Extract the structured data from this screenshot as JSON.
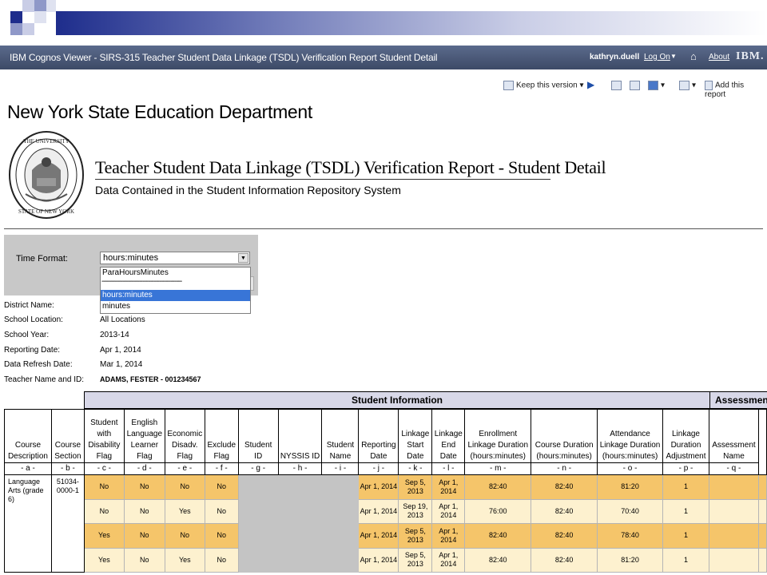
{
  "window": {
    "title": "IBM Cognos Viewer - SIRS-315 Teacher Student Data Linkage (TSDL) Verification Report Student Detail",
    "user": "kathryn.duell",
    "log_on": "Log On",
    "about": "About",
    "brand": "IBM."
  },
  "toolbar": {
    "keep_version": "Keep this version",
    "add_report": "Add this report"
  },
  "report": {
    "org": "New York State Education Department",
    "title": "Teacher Student Data Linkage (TSDL) Verification Report - Student Detail",
    "subtitle": "Data Contained in the Student Information Repository System"
  },
  "prompt": {
    "label": "Time Format:",
    "selected": "hours:minutes",
    "options": [
      "ParaHoursMinutes",
      "-------------------------------------------",
      "hours:minutes",
      "minutes"
    ]
  },
  "info": [
    {
      "label": "District Name:",
      "value": ""
    },
    {
      "label": "School Location:",
      "value": "All Locations"
    },
    {
      "label": "School Year:",
      "value": "2013-14"
    },
    {
      "label": "Reporting Date:",
      "value": "Apr 1, 2014"
    },
    {
      "label": "Data Refresh Date:",
      "value": "Mar 1, 2014"
    },
    {
      "label": "Teacher Name and ID:",
      "value": "ADAMS, FESTER - 001234567"
    }
  ],
  "table": {
    "group_student": "Student Information",
    "group_assess": "Assessmen",
    "headers": [
      {
        "label": "Course Description",
        "letter": "- a -"
      },
      {
        "label": "Course Section",
        "letter": "- b -"
      },
      {
        "label": "Student with Disability Flag",
        "letter": "- c -"
      },
      {
        "label": "English Language Learner Flag",
        "letter": "- d -"
      },
      {
        "label": "Economic Disadv. Flag",
        "letter": "- e -"
      },
      {
        "label": "Exclude Flag",
        "letter": "- f -"
      },
      {
        "label": "Student ID",
        "letter": "- g -"
      },
      {
        "label": "NYSSIS ID",
        "letter": "- h -"
      },
      {
        "label": "Student Name",
        "letter": "- i -"
      },
      {
        "label": "Reporting Date",
        "letter": "- j -"
      },
      {
        "label": "Linkage Start Date",
        "letter": "- k -"
      },
      {
        "label": "Linkage End Date",
        "letter": "- l -"
      },
      {
        "label": "Enrollment Linkage Duration (hours:minutes)",
        "letter": "- m -"
      },
      {
        "label": "Course Duration (hours:minutes)",
        "letter": "- n -"
      },
      {
        "label": "Attendance Linkage Duration (hours:minutes)",
        "letter": "- o -"
      },
      {
        "label": "Linkage Duration Adjustment",
        "letter": "- p -"
      },
      {
        "label": "Assessment Name",
        "letter": "- q -"
      }
    ],
    "course_description": "Language Arts (grade 6)",
    "course_section": "51034-0000-1",
    "rows": [
      {
        "c": "No",
        "d": "No",
        "e": "No",
        "f": "No",
        "j": "Apr 1, 2014",
        "k": "Sep 5, 2013",
        "l": "Apr 1, 2014",
        "m": "82:40",
        "n": "82:40",
        "o": "81:20",
        "p": "1"
      },
      {
        "c": "No",
        "d": "No",
        "e": "Yes",
        "f": "No",
        "j": "Apr 1, 2014",
        "k": "Sep 19, 2013",
        "l": "Apr 1, 2014",
        "m": "76:00",
        "n": "82:40",
        "o": "70:40",
        "p": "1"
      },
      {
        "c": "Yes",
        "d": "No",
        "e": "No",
        "f": "No",
        "j": "Apr 1, 2014",
        "k": "Sep 5, 2013",
        "l": "Apr 1, 2014",
        "m": "82:40",
        "n": "82:40",
        "o": "78:40",
        "p": "1"
      },
      {
        "c": "Yes",
        "d": "No",
        "e": "Yes",
        "f": "No",
        "j": "Apr 1, 2014",
        "k": "Sep 5, 2013",
        "l": "Apr 1, 2014",
        "m": "82:40",
        "n": "82:40",
        "o": "81:20",
        "p": "1"
      }
    ]
  },
  "colors": {
    "header_bar": "#4a5878",
    "row_odd": "#f5c56a",
    "row_even": "#fdf1cf",
    "group_header": "#d8d8e8",
    "select_highlight": "#3875d7"
  }
}
